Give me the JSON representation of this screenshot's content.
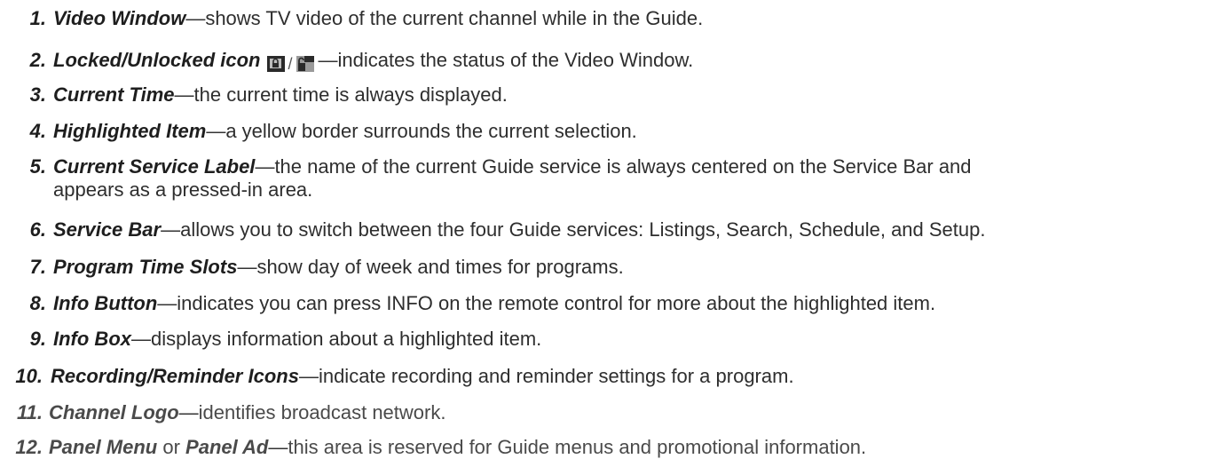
{
  "items": [
    {
      "number": "1.",
      "term": "Video Window",
      "desc": "shows TV video of the current channel while in the Guide."
    },
    {
      "number": "2.",
      "term": "Locked/Unlocked icon",
      "desc": "indicates the status of the Video Window.",
      "icons": [
        "locked-icon",
        "unlocked-icon"
      ],
      "icon_separator": "/"
    },
    {
      "number": "3.",
      "term": "Current Time",
      "desc": "the current time is always displayed."
    },
    {
      "number": "4.",
      "term": "Highlighted Item",
      "desc": "a yellow border surrounds the current selection."
    },
    {
      "number": "5.",
      "term": "Current Service Label",
      "desc": "the name of the current Guide service is always centered on the Service Bar and",
      "desc_cont": "appears as a pressed-in area."
    },
    {
      "number": "6.",
      "term": "Service Bar",
      "desc": "allows you to switch between the four Guide services:  Listings, Search, Schedule, and Setup."
    },
    {
      "number": "7.",
      "term": "Program Time Slots",
      "desc": "show day of week and times for programs."
    },
    {
      "number": "8.",
      "term": "Info Button",
      "desc": "indicates you can press INFO on the remote control for more about the highlighted item."
    },
    {
      "number": "9.",
      "term": "Info Box",
      "desc": "displays information about a highlighted item."
    },
    {
      "number": "10.",
      "term": "Recording/Reminder Icons",
      "desc": "indicate recording and reminder settings for a program."
    },
    {
      "number": "11.",
      "term": "Channel Logo",
      "desc": "identifies broadcast network."
    },
    {
      "number": "12.",
      "term": "Panel Menu",
      "term_or": " or ",
      "term2": "Panel Ad",
      "desc": "this area is reserved for Guide menus and promotional information."
    }
  ],
  "dash": "—",
  "colors": {
    "text": "#262626",
    "icon_dark": "#2a2a2a",
    "icon_light": "#9a9a9a"
  }
}
